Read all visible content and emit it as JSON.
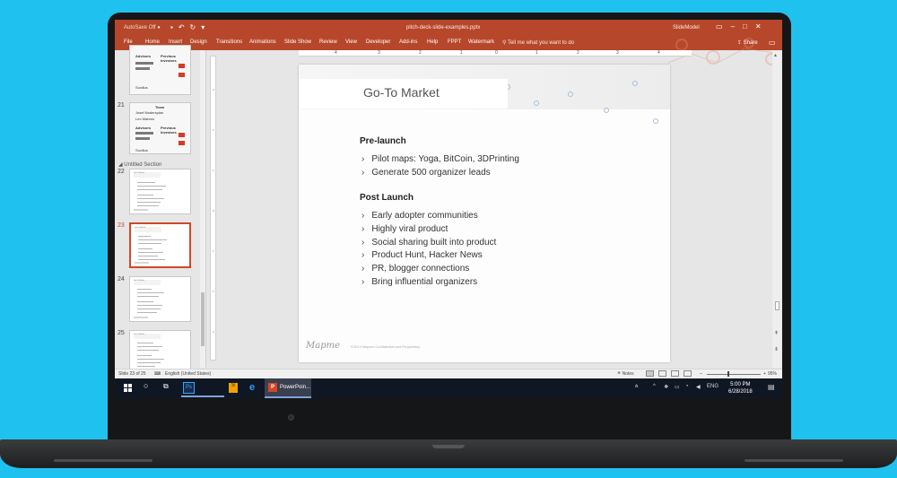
{
  "app": {
    "autosave_label": "AutoSave",
    "autosave_state": "Off",
    "file_title": "pitch-deck-slide-examples.pptx",
    "account": "SlideModel",
    "tell_me": "Tell me what you want to do",
    "share_label": "Share"
  },
  "ribbon_tabs": [
    "File",
    "Home",
    "Insert",
    "Design",
    "Transitions",
    "Animations",
    "Slide Show",
    "Review",
    "View",
    "Developer",
    "Add-ins",
    "Help",
    "FPPT",
    "Watermark"
  ],
  "thumbnails": {
    "slide20": {
      "advisors": "Advisors",
      "investors": "Previous Investors",
      "logo": "Sucilius"
    },
    "slide21": {
      "number": "21",
      "team": "Team",
      "member1": "Josef Naderspian",
      "member2": "Leo Mabros",
      "advisors": "Advisors",
      "investors": "Previous Investors",
      "logo": "Sucilius"
    },
    "section_label": "Untitled Section",
    "numbers": [
      "22",
      "23",
      "24",
      "25"
    ],
    "mini_title": "Go-To Market"
  },
  "ruler_top": [
    "4",
    "3",
    "2",
    "1",
    "0",
    "1",
    "2",
    "3",
    "4"
  ],
  "ruler_left": [
    "3",
    "2",
    "1",
    "0",
    "1",
    "2",
    "3"
  ],
  "slide": {
    "title": "Go-To Market",
    "prelaunch_heading": "Pre-launch",
    "prelaunch_items": [
      "Pilot maps: Yoga, BitCoin, 3DPrinting",
      "Generate 500 organizer leads"
    ],
    "postlaunch_heading": "Post Launch",
    "postlaunch_items": [
      "Early adopter communities",
      "Highly viral product",
      "Social sharing built into product",
      "Product Hunt, Hacker News",
      "PR, blogger connections",
      "Bring influential organizers"
    ],
    "logo": "Mapme",
    "confidential": "©2014 Mapme Confidential and Proprietary"
  },
  "status": {
    "slide_counter": "Slide 23 of 25",
    "language": "English (United States)",
    "notes": "Notes",
    "zoom": "95%"
  },
  "taskbar": {
    "ps_label": "Ps",
    "ppt_label": "PowerPoin...",
    "ime": "ENG",
    "time": "5:00 PM",
    "date": "6/28/2018"
  }
}
